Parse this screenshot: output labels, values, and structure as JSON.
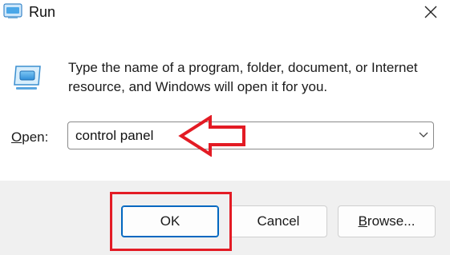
{
  "window": {
    "title": "Run",
    "icons": {
      "app": "run-icon",
      "close": "close-icon"
    }
  },
  "description": "Type the name of a program, folder, document, or Internet resource, and Windows will open it for you.",
  "open_field": {
    "label_accel": "O",
    "label_rest": "pen:",
    "value": "control panel",
    "dropdown_icon": "chevron-down-icon"
  },
  "buttons": {
    "ok": "OK",
    "cancel": "Cancel",
    "browse_accel": "B",
    "browse_rest": "rowse..."
  },
  "annotations": {
    "color": "#e31b24",
    "arrow_points_to": "open-input",
    "box_highlights": "ok-button"
  }
}
